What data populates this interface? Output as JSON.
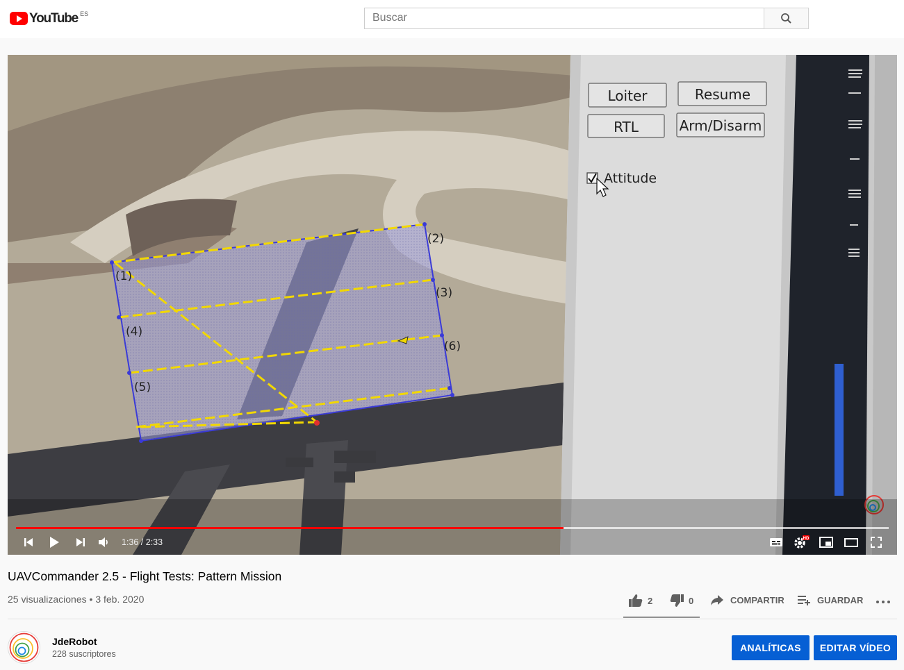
{
  "header": {
    "logo_text": "YouTube",
    "region_code": "ES",
    "search_placeholder": "Buscar"
  },
  "player": {
    "overlay_buttons": {
      "loiter": "Loiter",
      "resume": "Resume",
      "rtl": "RTL",
      "arm_disarm": "Arm/Disarm"
    },
    "attitude_label": "Attitude",
    "attitude_checked": true,
    "map_labels": [
      "(1)",
      "(2)",
      "(3)",
      "(4)",
      "(5)",
      "(6)"
    ],
    "time_display": "1:36 / 2:33",
    "progress_played_fraction": 0.627,
    "progress_loaded_fraction": 1.0,
    "hd_badge": "HD"
  },
  "video": {
    "title": "UAVCommander 2.5 - Flight Tests: Pattern Mission",
    "views": "25 visualizaciones",
    "separator": "•",
    "date": "3 feb. 2020",
    "likes": "2",
    "dislikes": "0",
    "share_label": "COMPARTIR",
    "save_label": "GUARDAR"
  },
  "channel": {
    "name": "JdeRobot",
    "subscribers": "228 suscriptores"
  },
  "buttons": {
    "analytics": "ANALÍTICAS",
    "edit_video": "EDITAR VÍDEO"
  },
  "colors": {
    "brand_red": "#ff0000",
    "progress_red": "#ff0000",
    "button_blue": "#065fd4",
    "mission_polygon": "#3a3ad8",
    "pattern_line": "#f2d800"
  }
}
